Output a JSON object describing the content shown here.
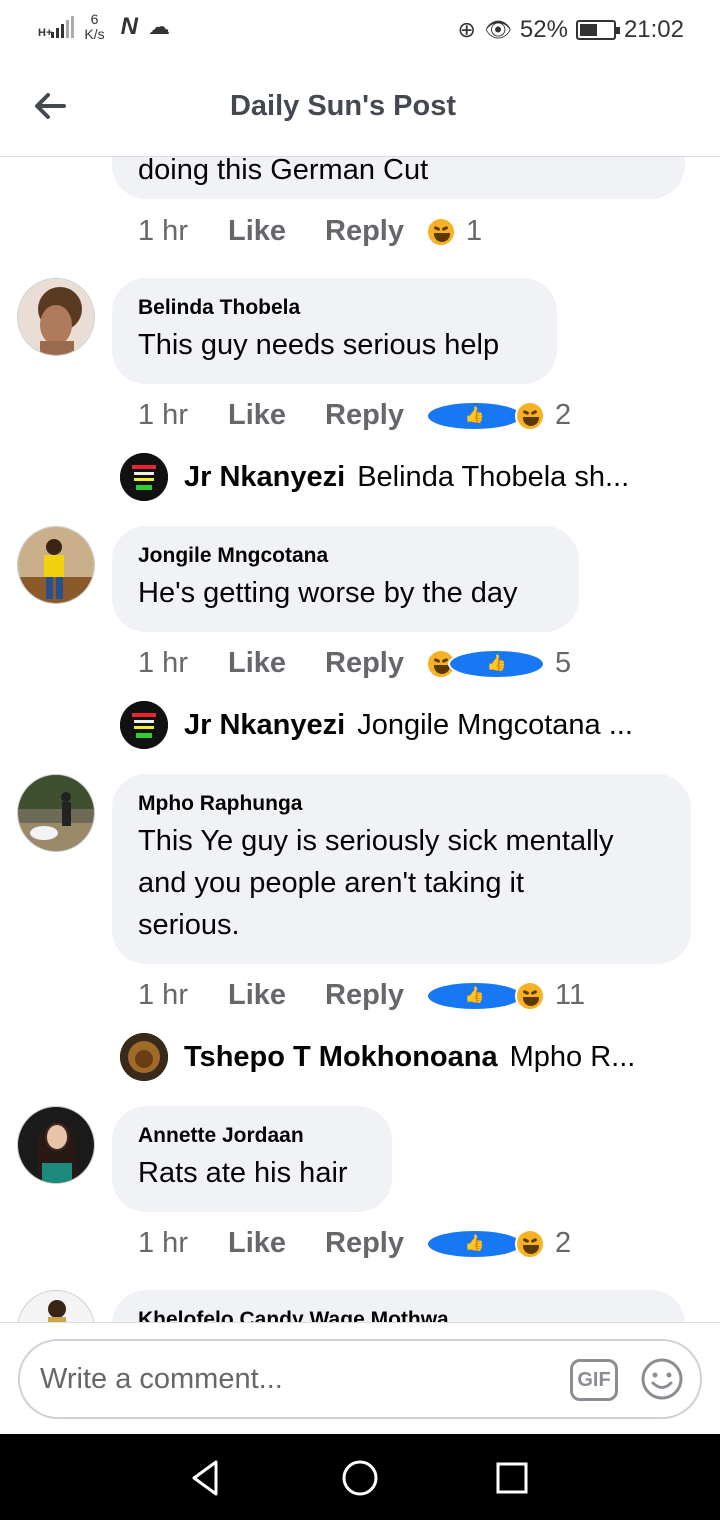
{
  "status_bar": {
    "network": "H+",
    "speed_value": "6",
    "speed_unit": "K/s",
    "battery_percent": "52%",
    "battery_level": 0.52,
    "time": "21:02"
  },
  "header": {
    "title": "Daily Sun's Post"
  },
  "comments": {
    "top_partial": {
      "text": "doing this German Cut",
      "time": "1 hr",
      "like_label": "Like",
      "reply_label": "Reply",
      "reactions": [
        "haha"
      ],
      "count": "1"
    },
    "items": [
      {
        "author": "Belinda Thobela",
        "text": "This guy needs serious help",
        "time": "1 hr",
        "like_label": "Like",
        "reply_label": "Reply",
        "reactions": [
          "like",
          "haha"
        ],
        "count": "2",
        "reply_preview": {
          "name": "Jr Nkanyezi",
          "snippet": "Belinda Thobela sh..."
        }
      },
      {
        "author": "Jongile Mngcotana",
        "text": "He's getting worse by the day",
        "time": "1 hr",
        "like_label": "Like",
        "reply_label": "Reply",
        "reactions": [
          "haha",
          "like"
        ],
        "count": "5",
        "reply_preview": {
          "name": "Jr Nkanyezi",
          "snippet": "Jongile Mngcotana ..."
        }
      },
      {
        "author": "Mpho Raphunga",
        "text_lines": [
          "This Ye guy is seriously sick mentally",
          "and you people aren't taking it",
          "serious."
        ],
        "time": "1 hr",
        "like_label": "Like",
        "reply_label": "Reply",
        "reactions": [
          "like",
          "haha"
        ],
        "count": "11",
        "reply_preview": {
          "name": "Tshepo T Mokhonoana",
          "snippet": "Mpho R..."
        }
      },
      {
        "author": "Annette Jordaan",
        "text": "Rats ate his hair",
        "time": "1 hr",
        "like_label": "Like",
        "reply_label": "Reply",
        "reactions": [
          "like",
          "haha"
        ],
        "count": "2"
      },
      {
        "author": "Khelofelo Candy Wage Mothwa"
      }
    ]
  },
  "composer": {
    "placeholder": "Write a comment...",
    "gif_label": "GIF"
  }
}
